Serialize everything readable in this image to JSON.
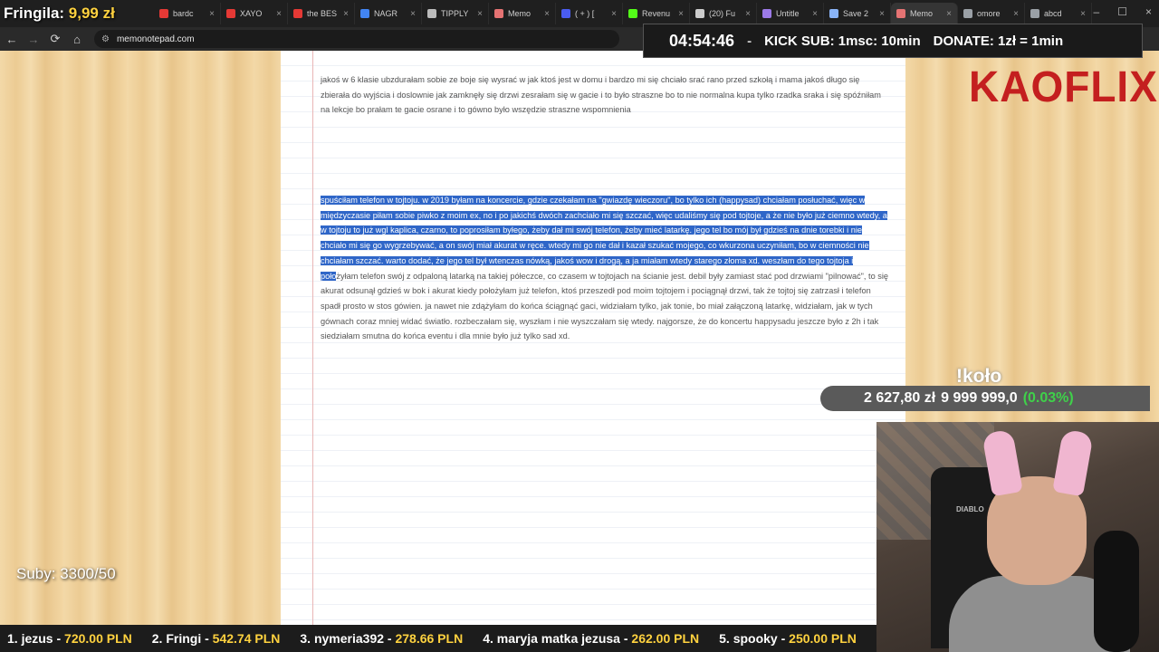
{
  "stream": {
    "fringila_label": "Fringila:",
    "fringila_amount": "9,99 zł",
    "timer": "04:54:46",
    "timer_sep": "-",
    "kick_sub": "KICK SUB: 1msc: 10min",
    "donate": "DONATE: 1zł = 1min",
    "suby": "Suby: 3300/50",
    "brand": "KAOFLIX",
    "kolo": "!koło",
    "money_current": "2 627,80 zł",
    "money_target": "9 999 999,0",
    "money_pct": "(0.03%)",
    "chair_logo": "DIABLO"
  },
  "tabs": [
    {
      "label": "bardc",
      "color": "#e53935"
    },
    {
      "label": "XAYO",
      "color": "#e53935"
    },
    {
      "label": "the BES",
      "color": "#e53935"
    },
    {
      "label": "NAGR",
      "color": "#4285f4"
    },
    {
      "label": "TIPPLY",
      "color": "#bbbbbb"
    },
    {
      "label": "Memo",
      "color": "#e57373"
    },
    {
      "label": "( + ) [",
      "color": "#4a5cf0"
    },
    {
      "label": "Revenu",
      "color": "#53fc18"
    },
    {
      "label": "(20) Fu",
      "color": "#cccccc"
    },
    {
      "label": "Untitle",
      "color": "#9c7ae8"
    },
    {
      "label": "Save 2",
      "color": "#8ab4f8"
    },
    {
      "label": "Memo",
      "color": "#e57373"
    },
    {
      "label": "omore",
      "color": "#9aa0a6"
    },
    {
      "label": "abcd",
      "color": "#9aa0a6"
    }
  ],
  "browser": {
    "url": "memonotepad.com",
    "back": "←",
    "forward": "→",
    "reload": "⟳",
    "home": "⌂",
    "tune": "⚙",
    "close": "×",
    "minimize": "–",
    "maximize": "☐"
  },
  "notepad": {
    "para1": "jakoś w 6 klasie ubzdurałam sobie ze boje się wysrać w jak ktoś jest w domu i bardzo mi się chciało srać rano przed szkołą i mama jakoś długo się zbierała do wyjścia i doslownie jak zamknęły się drzwi zesrałam się w gacie i to było straszne bo to nie normalna kupa tylko rzadka sraka i się spóźniłam na lekcje bo prałam te gacie osrane i to gówno było wszędzie straszne wspomnienia",
    "para2_selected": "spuściłam telefon w tojtoju. w 2019 byłam na koncercie, gdzie czekałam na \"gwiazdę wieczoru\", bo tylko ich (happysad) chciałam posłuchać, więc w międzyczasie piłam sobie piwko z moim ex, no i po jakichś dwóch zachciało mi się szczać, więc udaliśmy się pod tojtoje, a że nie było już ciemno wtedy, a w tojtoju to już wgl kaplica, czarno, to poprosiłam byłego, żeby dał mi swój telefon, żeby mieć latarkę. jego tel bo mój był gdzieś na dnie torebki i nie chciało mi się go wygrzebywać, a on swój miał akurat w ręce. wtedy mi go nie dał i kazał szukać mojego, co wkurzona uczyniłam, bo w ciemności nie chciałam szczać. warto dodać, że jego tel był wtenczas nówką, jakoś wow i drogą, a ja miałam wtedy starego złoma xd. weszłam do tego tojtoja i poło",
    "para2_rest": "żyłam telefon swój z odpaloną latarką na takiej półeczce, co czasem w tojtojach na ścianie jest. debil były zamiast stać pod drzwiami \"pilnować\", to się akurat odsunął gdzieś w bok i akurat kiedy położyłam już telefon, ktoś przeszedł pod moim tojtojem i pociągnął drzwi, tak że tojtoj się zatrzasł i telefon spadł prosto w stos gówien. ja nawet nie zdążyłam do końca ściągnąć gaci, widziałam tylko, jak tonie, bo miał załączoną latarkę, widziałam, jak w tych gównach coraz mniej widać światło. rozbeczałam się, wyszłam i nie wyszczałam się wtedy. najgorsze, że do koncertu happysadu jeszcze było z 2h i tak siedziałam smutna do końca eventu i dla mnie było już tylko sad xd."
  },
  "donors": [
    {
      "name": "1. jezus",
      "amount": "720.00 PLN"
    },
    {
      "name": "2. Fringi",
      "amount": "542.74 PLN"
    },
    {
      "name": "3. nymeria392",
      "amount": "278.66 PLN"
    },
    {
      "name": "4. maryja matka jezusa",
      "amount": "262.00 PLN"
    },
    {
      "name": "5. spooky",
      "amount": "250.00 PLN"
    }
  ]
}
